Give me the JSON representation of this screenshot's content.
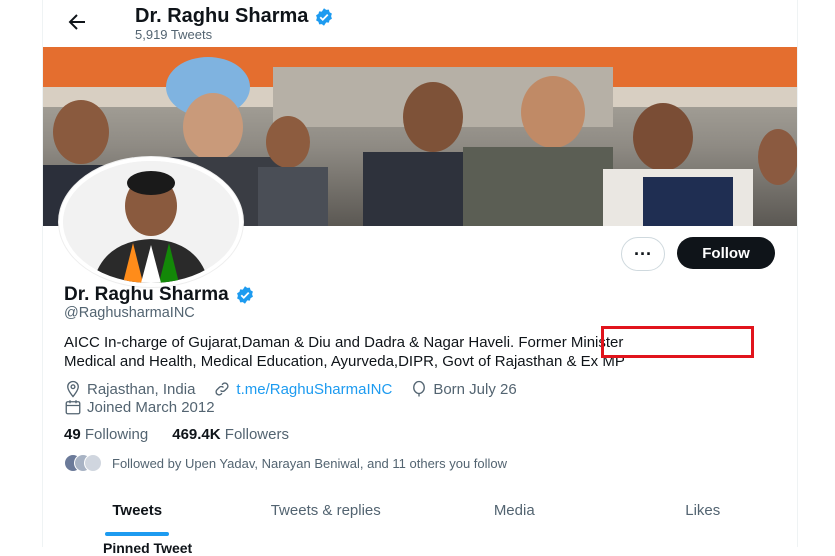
{
  "header": {
    "title": "Dr. Raghu Sharma",
    "tweet_count": "5,919 Tweets"
  },
  "profile": {
    "name": "Dr. Raghu Sharma",
    "handle": "@RaghusharmaINC",
    "bio_line1": "AICC In-charge of Gujarat,Daman & Diu and Dadra & Nagar Haveli. Former Minister",
    "bio_line2": "Medical and Health, Medical Education, Ayurveda,DIPR, Govt of Rajasthan & Ex MP",
    "location": "Rajasthan, India",
    "website": "t.me/RaghuSharmaINC",
    "birthday": "Born July 26",
    "joined": "Joined March 2012",
    "following_count": "49",
    "following_label": "Following",
    "followers_count": "469.4K",
    "followers_label": "Followers",
    "followed_by": "Followed by Upen Yadav, Narayan Beniwal, and 11 others you follow"
  },
  "actions": {
    "more_label": "···",
    "follow_label": "Follow"
  },
  "tabs": [
    {
      "label": "Tweets"
    },
    {
      "label": "Tweets & replies"
    },
    {
      "label": "Media"
    },
    {
      "label": "Likes"
    }
  ],
  "peek_text": "Pinned Tweet",
  "colors": {
    "accent": "#1d9bf0",
    "highlight_box": "#e1141c",
    "follow_bg": "#0f1419"
  }
}
